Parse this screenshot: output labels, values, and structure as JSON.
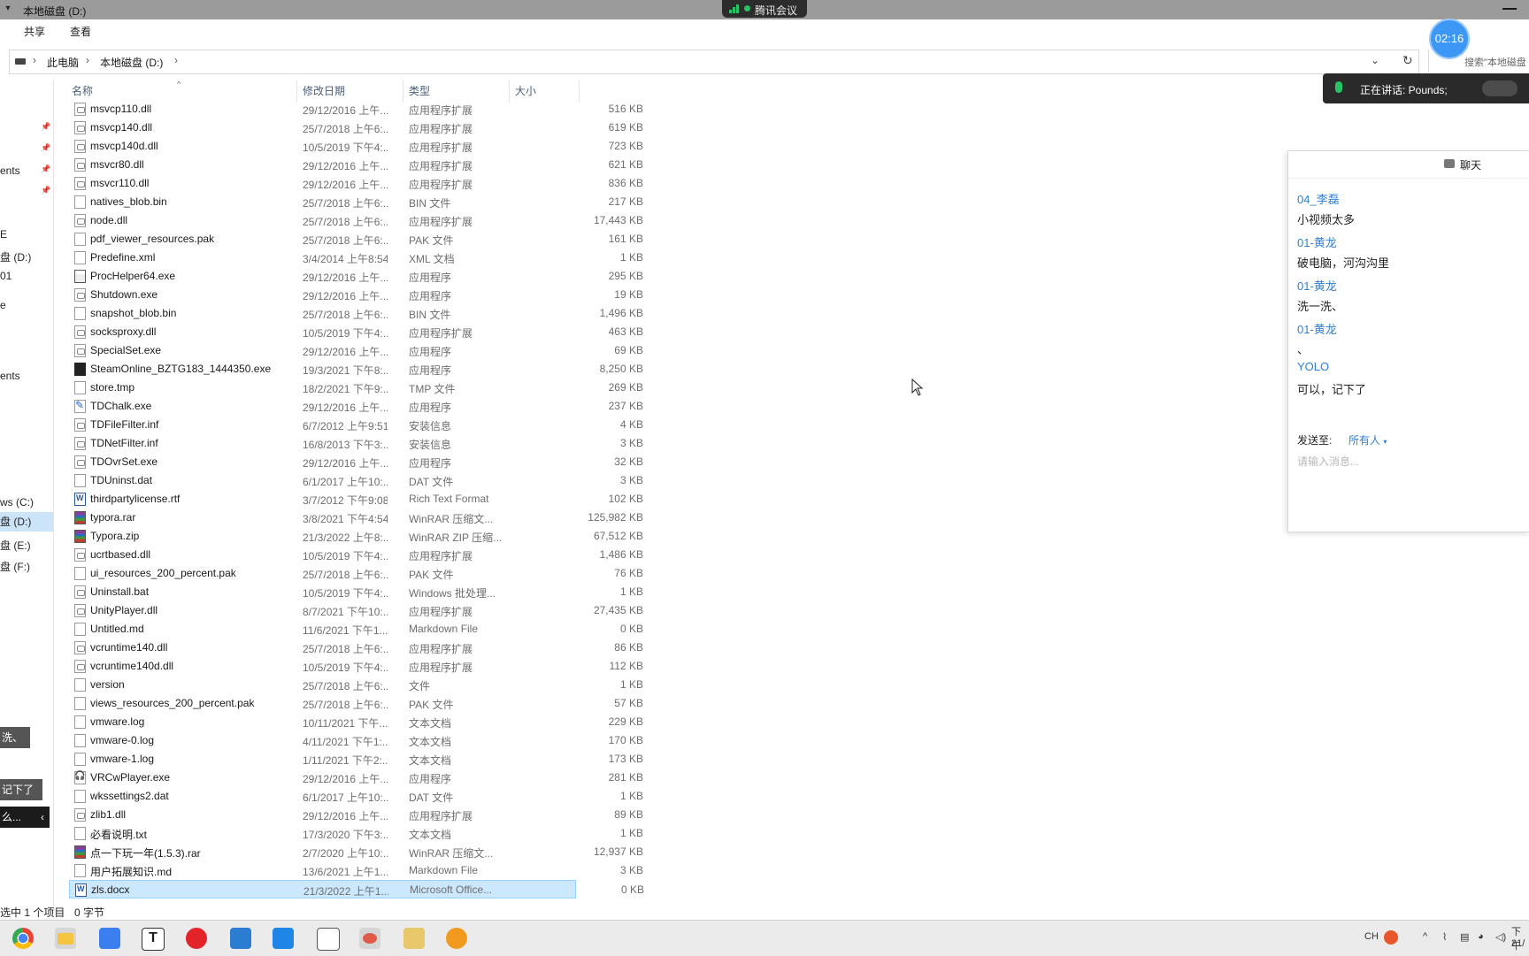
{
  "window": {
    "title": "本地磁盘 (D:)",
    "meeting_app": "腾讯会议"
  },
  "ribbon": {
    "tabs": [
      "共享",
      "查看"
    ]
  },
  "address": {
    "crumbs": [
      "此电脑",
      "本地磁盘 (D:)"
    ],
    "search_placeholder": "搜索\"本地磁盘"
  },
  "nav": {
    "items": [
      "ents",
      "E",
      "盘 (D:)",
      "01",
      "e",
      "ents",
      "ws (C:)",
      "盘 (D:)",
      "盘 (E:)",
      "盘 (F:)"
    ]
  },
  "columns": {
    "name": "名称",
    "date": "修改日期",
    "type": "类型",
    "size": "大小"
  },
  "files": [
    {
      "name": "msvcp110.dll",
      "date": "29/12/2016 上午...",
      "type": "应用程序扩展",
      "size": "516 KB",
      "icon": "dll"
    },
    {
      "name": "msvcp140.dll",
      "date": "25/7/2018 上午6:...",
      "type": "应用程序扩展",
      "size": "619 KB",
      "icon": "dll"
    },
    {
      "name": "msvcp140d.dll",
      "date": "10/5/2019 下午4:...",
      "type": "应用程序扩展",
      "size": "723 KB",
      "icon": "dll"
    },
    {
      "name": "msvcr80.dll",
      "date": "29/12/2016 上午...",
      "type": "应用程序扩展",
      "size": "621 KB",
      "icon": "dll"
    },
    {
      "name": "msvcr110.dll",
      "date": "29/12/2016 上午...",
      "type": "应用程序扩展",
      "size": "836 KB",
      "icon": "dll"
    },
    {
      "name": "natives_blob.bin",
      "date": "25/7/2018 上午6:...",
      "type": "BIN 文件",
      "size": "217 KB",
      "icon": "file"
    },
    {
      "name": "node.dll",
      "date": "25/7/2018 上午6:...",
      "type": "应用程序扩展",
      "size": "17,443 KB",
      "icon": "dll"
    },
    {
      "name": "pdf_viewer_resources.pak",
      "date": "25/7/2018 上午6:...",
      "type": "PAK 文件",
      "size": "161 KB",
      "icon": "file"
    },
    {
      "name": "Predefine.xml",
      "date": "3/4/2014 上午8:54",
      "type": "XML 文档",
      "size": "1 KB",
      "icon": "file"
    },
    {
      "name": "ProcHelper64.exe",
      "date": "29/12/2016 上午...",
      "type": "应用程序",
      "size": "295 KB",
      "icon": "win"
    },
    {
      "name": "Shutdown.exe",
      "date": "29/12/2016 上午...",
      "type": "应用程序",
      "size": "19 KB",
      "icon": "exe"
    },
    {
      "name": "snapshot_blob.bin",
      "date": "25/7/2018 上午6:...",
      "type": "BIN 文件",
      "size": "1,496 KB",
      "icon": "file"
    },
    {
      "name": "socksproxy.dll",
      "date": "10/5/2019 下午4:...",
      "type": "应用程序扩展",
      "size": "463 KB",
      "icon": "dll"
    },
    {
      "name": "SpecialSet.exe",
      "date": "29/12/2016 上午...",
      "type": "应用程序",
      "size": "69 KB",
      "icon": "exe"
    },
    {
      "name": "SteamOnline_BZTG183_1444350.exe",
      "date": "19/3/2021 下午8:...",
      "type": "应用程序",
      "size": "8,250 KB",
      "icon": "game"
    },
    {
      "name": "store.tmp",
      "date": "18/2/2021 下午9:...",
      "type": "TMP 文件",
      "size": "269 KB",
      "icon": "file"
    },
    {
      "name": "TDChalk.exe",
      "date": "29/12/2016 上午...",
      "type": "应用程序",
      "size": "237 KB",
      "icon": "pen"
    },
    {
      "name": "TDFileFilter.inf",
      "date": "6/7/2012 上午9:51",
      "type": "安装信息",
      "size": "4 KB",
      "icon": "dll"
    },
    {
      "name": "TDNetFilter.inf",
      "date": "16/8/2013 下午3:...",
      "type": "安装信息",
      "size": "3 KB",
      "icon": "dll"
    },
    {
      "name": "TDOvrSet.exe",
      "date": "29/12/2016 上午...",
      "type": "应用程序",
      "size": "32 KB",
      "icon": "exe"
    },
    {
      "name": "TDUninst.dat",
      "date": "6/1/2017 上午10:...",
      "type": "DAT 文件",
      "size": "3 KB",
      "icon": "file"
    },
    {
      "name": "thirdpartylicense.rtf",
      "date": "3/7/2012 下午9:08",
      "type": "Rich Text Format",
      "size": "102 KB",
      "icon": "doc"
    },
    {
      "name": "typora.rar",
      "date": "3/8/2021 下午4:54",
      "type": "WinRAR 压缩文...",
      "size": "125,982 KB",
      "icon": "rar"
    },
    {
      "name": "Typora.zip",
      "date": "21/3/2022 上午8:...",
      "type": "WinRAR ZIP 压缩...",
      "size": "67,512 KB",
      "icon": "rar"
    },
    {
      "name": "ucrtbased.dll",
      "date": "10/5/2019 下午4:...",
      "type": "应用程序扩展",
      "size": "1,486 KB",
      "icon": "dll"
    },
    {
      "name": "ui_resources_200_percent.pak",
      "date": "25/7/2018 上午6:...",
      "type": "PAK 文件",
      "size": "76 KB",
      "icon": "file"
    },
    {
      "name": "Uninstall.bat",
      "date": "10/5/2019 下午4:...",
      "type": "Windows 批处理...",
      "size": "1 KB",
      "icon": "exe"
    },
    {
      "name": "UnityPlayer.dll",
      "date": "8/7/2021 下午10:...",
      "type": "应用程序扩展",
      "size": "27,435 KB",
      "icon": "dll"
    },
    {
      "name": "Untitled.md",
      "date": "11/6/2021 下午1...",
      "type": "Markdown File",
      "size": "0 KB",
      "icon": "file"
    },
    {
      "name": "vcruntime140.dll",
      "date": "25/7/2018 上午6:...",
      "type": "应用程序扩展",
      "size": "86 KB",
      "icon": "dll"
    },
    {
      "name": "vcruntime140d.dll",
      "date": "10/5/2019 下午4:...",
      "type": "应用程序扩展",
      "size": "112 KB",
      "icon": "dll"
    },
    {
      "name": "version",
      "date": "25/7/2018 上午6:...",
      "type": "文件",
      "size": "1 KB",
      "icon": "file"
    },
    {
      "name": "views_resources_200_percent.pak",
      "date": "25/7/2018 上午6:...",
      "type": "PAK 文件",
      "size": "57 KB",
      "icon": "file"
    },
    {
      "name": "vmware.log",
      "date": "10/11/2021 下午...",
      "type": "文本文档",
      "size": "229 KB",
      "icon": "file"
    },
    {
      "name": "vmware-0.log",
      "date": "4/11/2021 下午1:...",
      "type": "文本文档",
      "size": "170 KB",
      "icon": "file"
    },
    {
      "name": "vmware-1.log",
      "date": "1/11/2021 下午2:...",
      "type": "文本文档",
      "size": "173 KB",
      "icon": "file"
    },
    {
      "name": "VRCwPlayer.exe",
      "date": "29/12/2016 上午...",
      "type": "应用程序",
      "size": "281 KB",
      "icon": "head"
    },
    {
      "name": "wkssettings2.dat",
      "date": "6/1/2017 上午10:...",
      "type": "DAT 文件",
      "size": "1 KB",
      "icon": "file"
    },
    {
      "name": "zlib1.dll",
      "date": "29/12/2016 上午...",
      "type": "应用程序扩展",
      "size": "89 KB",
      "icon": "dll"
    },
    {
      "name": "必看说明.txt",
      "date": "17/3/2020 下午3:...",
      "type": "文本文档",
      "size": "1 KB",
      "icon": "file"
    },
    {
      "name": "点一下玩一年(1.5.3).rar",
      "date": "2/7/2020 上午10:...",
      "type": "WinRAR 压缩文...",
      "size": "12,937 KB",
      "icon": "rar"
    },
    {
      "name": "用户拓展知识.md",
      "date": "13/6/2021 上午1...",
      "type": "Markdown File",
      "size": "3 KB",
      "icon": "file"
    },
    {
      "name": "zls.docx",
      "date": "21/3/2022 上午1...",
      "type": "Microsoft Office...",
      "size": "0 KB",
      "icon": "doc",
      "selected": true
    }
  ],
  "status": {
    "selection": "选中 1 个项目",
    "size": "0 字节"
  },
  "left_toasts": [
    "洗、",
    "记下了",
    "么..."
  ],
  "meeting": {
    "timer": "02:16",
    "speaking_label": "正在讲话: Pounds;",
    "chat": {
      "title": "聊天",
      "messages": [
        {
          "name": "04_李磊",
          "text": "小视频太多"
        },
        {
          "name": "01-黄龙",
          "text": "破电脑，河沟沟里"
        },
        {
          "name": "01-黄龙",
          "text": "洗一洗、"
        },
        {
          "name": "01-黄龙",
          "text": "、"
        },
        {
          "name": "YOLO",
          "text": "可以，记下了"
        }
      ],
      "send_to_label": "发送至:",
      "send_to_value": "所有人",
      "input_placeholder": "请输入消息..."
    }
  },
  "taskbar": {
    "apps": [
      "chrome-icon",
      "file-explorer-icon",
      "feishu-icon",
      "typora-icon",
      "netease-music-icon",
      "app-window-icon",
      "app-cloud-icon",
      "vmware-icon",
      "app-bird-icon",
      "paint-icon",
      "settings-gear-icon"
    ],
    "tray": {
      "lang": "CH",
      "time": "下午",
      "date": "21/"
    }
  }
}
